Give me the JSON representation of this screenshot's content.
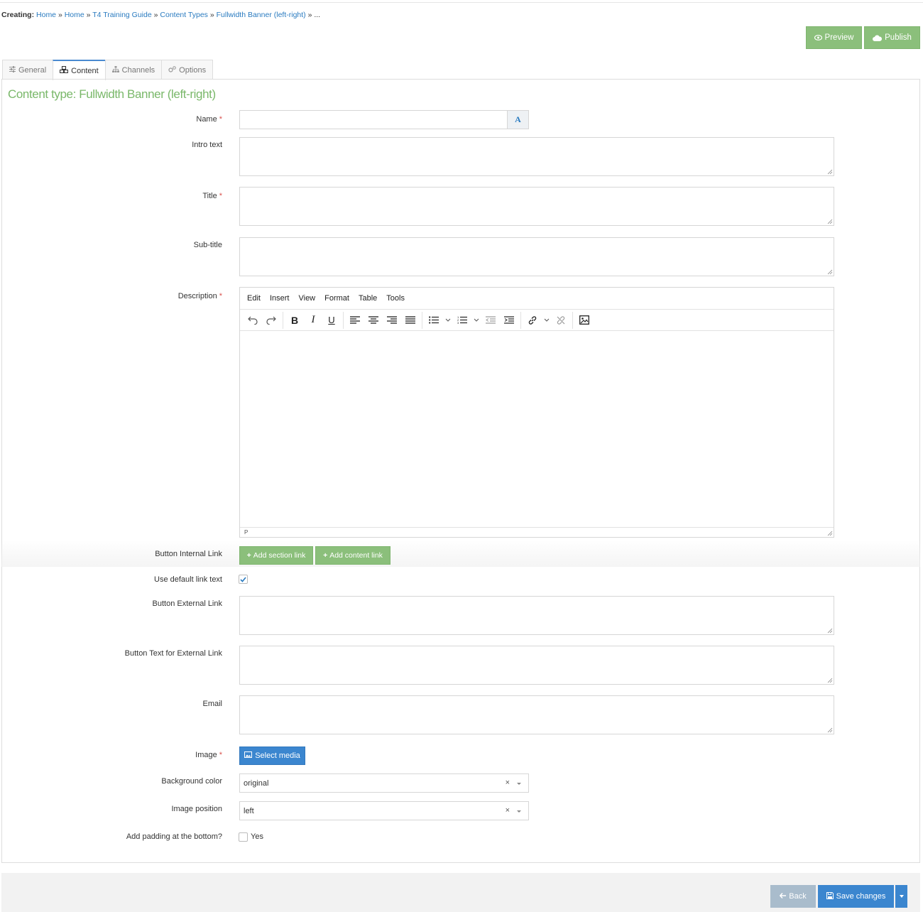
{
  "breadcrumb": {
    "prefix": "Creating:",
    "items": [
      "Home",
      "Home",
      "T4 Training Guide",
      "Content Types",
      "Fullwidth Banner (left-right)"
    ],
    "separator": "»",
    "ellipsis": "..."
  },
  "actions": {
    "preview": "Preview",
    "publish": "Publish"
  },
  "tabs": [
    {
      "label": "General",
      "icon": "sliders-icon",
      "active": false
    },
    {
      "label": "Content",
      "icon": "cubes-icon",
      "active": true
    },
    {
      "label": "Channels",
      "icon": "sitemap-icon",
      "active": false
    },
    {
      "label": "Options",
      "icon": "cogs-icon",
      "active": false
    }
  ],
  "content_title": "Content type: Fullwidth Banner (left-right)",
  "fields": {
    "name": {
      "label": "Name",
      "value": ""
    },
    "intro_text": {
      "label": "Intro text",
      "value": ""
    },
    "title": {
      "label": "Title",
      "value": ""
    },
    "sub_title": {
      "label": "Sub-title",
      "value": ""
    },
    "description": {
      "label": "Description"
    },
    "button_internal_link": {
      "label": "Button Internal Link",
      "add_section": "Add section link",
      "add_content": "Add content link"
    },
    "use_default_link_text": {
      "label": "Use default link text",
      "checked": true
    },
    "button_external_link": {
      "label": "Button External Link",
      "value": ""
    },
    "button_text_external": {
      "label": "Button Text for External Link",
      "value": ""
    },
    "email": {
      "label": "Email",
      "value": ""
    },
    "image": {
      "label": "Image",
      "button": "Select media"
    },
    "background_color": {
      "label": "Background color",
      "value": "original"
    },
    "image_position": {
      "label": "Image position",
      "value": "left"
    },
    "add_padding": {
      "label": "Add padding at the bottom?",
      "option": "Yes",
      "checked": false
    }
  },
  "editor": {
    "menu": [
      "Edit",
      "Insert",
      "View",
      "Format",
      "Table",
      "Tools"
    ],
    "status_path": "P"
  },
  "footer": {
    "back": "Back",
    "save": "Save changes"
  },
  "colors": {
    "accent_green": "#8bbf7b",
    "title_green": "#7ab86a",
    "primary_blue": "#3b86cf",
    "link_blue": "#2a7bc0",
    "required_red": "#d9534f"
  }
}
